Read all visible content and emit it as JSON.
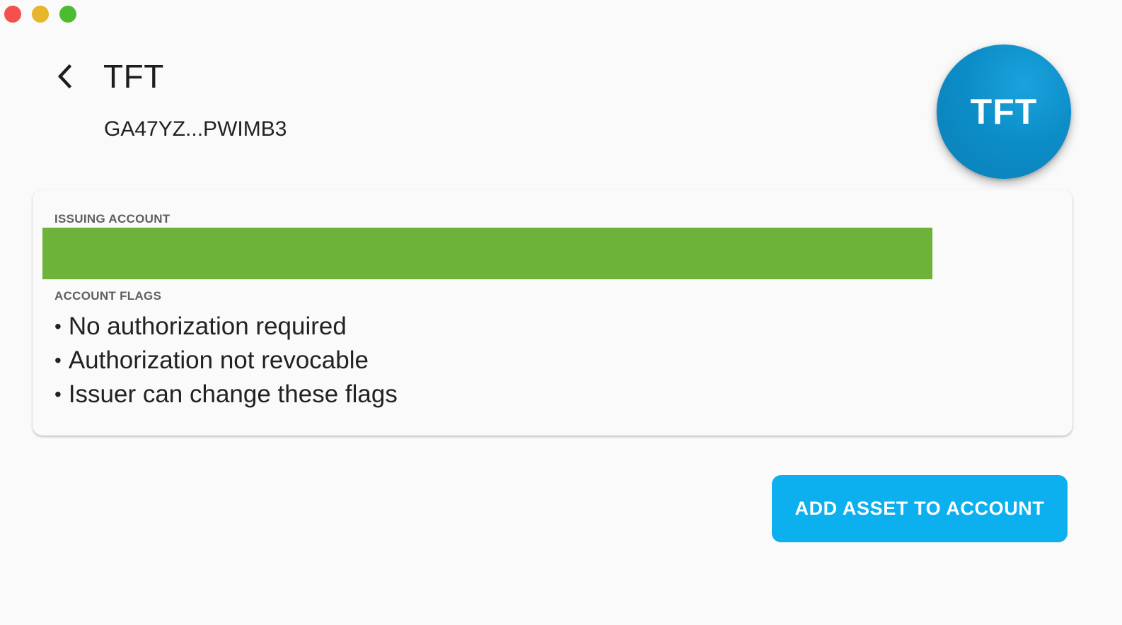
{
  "window": {
    "controls": [
      "close",
      "minimize",
      "maximize"
    ]
  },
  "header": {
    "back_icon": "chevron-left-icon",
    "title": "TFT",
    "issuer_short": "GA47YZ...PWIMB3",
    "logo_text": "TFT",
    "logo_color": "#0c8dc8"
  },
  "card": {
    "issuing_account_label": "ISSUING ACCOUNT",
    "issuing_account_bar_color": "#6db33a",
    "account_flags_label": "ACCOUNT FLAGS",
    "flags": [
      "No authorization required",
      "Authorization not revocable",
      "Issuer can change these flags"
    ]
  },
  "actions": {
    "add_asset_label": "ADD ASSET TO ACCOUNT",
    "button_color": "#0cb0ef"
  }
}
